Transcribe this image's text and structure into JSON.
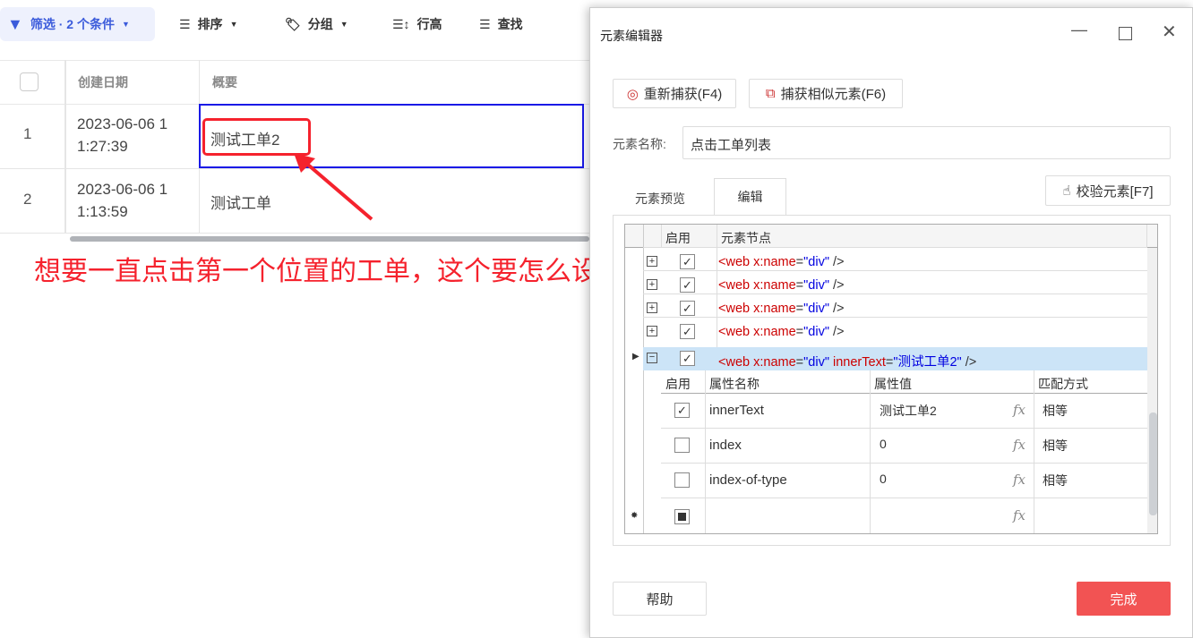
{
  "toolbar": {
    "filter": "筛选 · 2 个条件",
    "sort": "排序",
    "group": "分组",
    "row_height": "行高",
    "find": "查找"
  },
  "table": {
    "columns": [
      "创建日期",
      "概要"
    ],
    "rows": [
      {
        "num": "1",
        "date1": "2023-06-06 1",
        "date2": "1:27:39",
        "summary": "测试工单2"
      },
      {
        "num": "2",
        "date1": "2023-06-06 1",
        "date2": "1:13:59",
        "summary": "测试工单"
      }
    ]
  },
  "annotation": "想要一直点击第一个位置的工单，这个要怎么设置",
  "dialog": {
    "title": "元素编辑器",
    "recapture": "重新捕获(F4)",
    "capture_similar": "捕获相似元素(F6)",
    "name_label": "元素名称:",
    "name_value": "点击工单列表",
    "tabs": [
      "元素预览",
      "编辑"
    ],
    "verify": "校验元素[F7]",
    "tree_headers": [
      "启用",
      "元素节点"
    ],
    "nodes": [
      {
        "tag": "<web ",
        "attr": "x:name",
        "eq": "=",
        "val": "\"div\"",
        "end": " />"
      }
    ],
    "selected_node": {
      "tag": "<web ",
      "attr": "x:name",
      "eq": "=",
      "val": "\"div\"",
      "attr2": " innerText",
      "val2": "\"测试工单2\"",
      "end": " />"
    },
    "attr_headers": [
      "启用",
      "属性名称",
      "属性值",
      "匹配方式"
    ],
    "attrs": [
      {
        "name": "innerText",
        "value": "测试工单2",
        "match": "相等",
        "checked": true
      },
      {
        "name": "index",
        "value": "0",
        "match": "相等",
        "checked": false
      },
      {
        "name": "index-of-type",
        "value": "0",
        "match": "相等",
        "checked": false
      }
    ],
    "fx": "fx",
    "help": "帮助",
    "done": "完成",
    "accent": "#f25353"
  }
}
